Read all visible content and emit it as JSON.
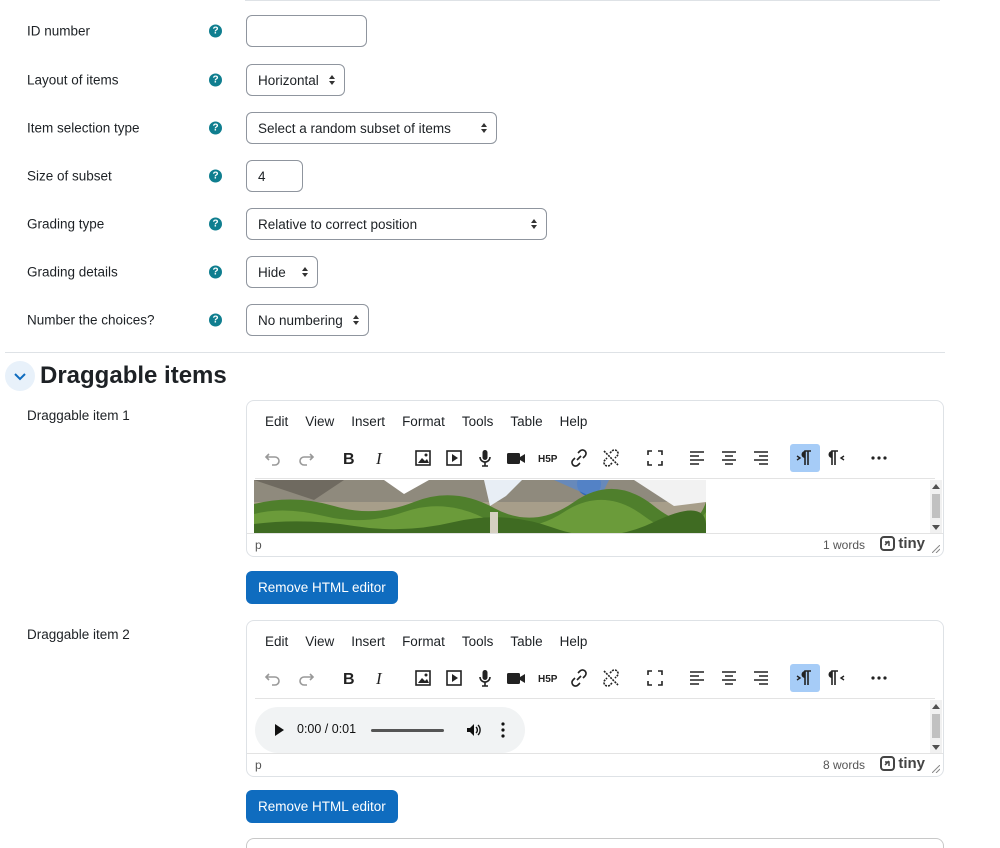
{
  "form": {
    "fields": [
      {
        "label": "ID number",
        "value": "",
        "type": "text"
      },
      {
        "label": "Layout of items",
        "value": "Horizontal",
        "type": "select"
      },
      {
        "label": "Item selection type",
        "value": "Select a random subset of items",
        "type": "select"
      },
      {
        "label": "Size of subset",
        "value": "4",
        "type": "text"
      },
      {
        "label": "Grading type",
        "value": "Relative to correct position",
        "type": "select"
      },
      {
        "label": "Grading details",
        "value": "Hide",
        "type": "select"
      },
      {
        "label": "Number the choices?",
        "value": "No numbering",
        "type": "select"
      }
    ],
    "help_glyph": "?"
  },
  "section": {
    "title": "Draggable items",
    "toggle_icon": "chevron-down-icon"
  },
  "editor_menu": [
    "Edit",
    "View",
    "Insert",
    "Format",
    "Tools",
    "Table",
    "Help"
  ],
  "toolbar_icons": [
    "undo-icon",
    "redo-icon",
    "bold-icon",
    "italic-icon",
    "image-icon",
    "media-icon",
    "record-audio-icon",
    "record-video-icon",
    "h5p-icon",
    "link-icon",
    "unlink-icon",
    "fullscreen-icon",
    "align-left-icon",
    "align-center-icon",
    "align-right-icon",
    "ltr-icon",
    "rtl-icon",
    "more-icon"
  ],
  "items": [
    {
      "label": "Draggable item 1",
      "path": "p",
      "words": "1 words",
      "button": "Remove HTML editor"
    },
    {
      "label": "Draggable item 2",
      "path": "p",
      "words": "8 words",
      "button": "Remove HTML editor",
      "audio_time": "0:00 / 0:01"
    }
  ],
  "brand": "tiny",
  "colors": {
    "primary": "#0f6cbf",
    "help": "#0f7e8f",
    "toolbar_active": "#a6ccf7"
  }
}
